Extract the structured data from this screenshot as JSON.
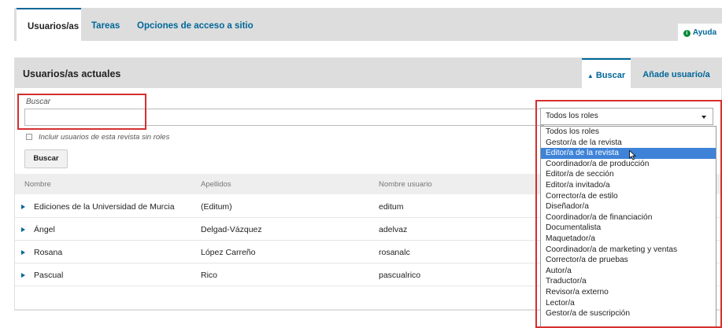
{
  "tabs": [
    {
      "label": "Usuarios/as"
    },
    {
      "label": "Tareas"
    },
    {
      "label": "Opciones de acceso a sitio"
    }
  ],
  "help_label": "Ayuda",
  "panel": {
    "title": "Usuarios/as actuales",
    "search_tab": "Buscar",
    "add_tab": "Añade usuario/a"
  },
  "search": {
    "label": "Buscar",
    "value": "",
    "checkbox_label": "Incluir usuarios de esta revista sin roles",
    "button_label": "Buscar"
  },
  "table": {
    "columns": [
      "Nombre",
      "Apellidos",
      "Nombre usuario"
    ],
    "rows": [
      [
        "Ediciones de la Universidad de Murcia",
        "(Editum)",
        "editum"
      ],
      [
        "Ángel",
        "Delgad-Vázquez",
        "adelvaz"
      ],
      [
        "Rosana",
        "López Carreño",
        "rosanalc"
      ],
      [
        "Pascual",
        "Rico",
        "pascualrico"
      ]
    ]
  },
  "roles": {
    "selected": "Todos los roles",
    "highlighted_index": 2,
    "options": [
      "Todos los roles",
      "Gestor/a de la revista",
      "Editor/a de la revista",
      "Coordinador/a de producción",
      "Editor/a de sección",
      "Editor/a invitado/a",
      "Corrector/a de estilo",
      "Diseñador/a",
      "Coordinador/a de financiación",
      "Documentalista",
      "Maquetador/a",
      "Coordinador/a de marketing y ventas",
      "Corrector/a de pruebas",
      "Autor/a",
      "Traductor/a",
      "Revisor/a externo",
      "Lector/a",
      "Gestor/a de suscripción"
    ]
  },
  "colors": {
    "accent": "#006798",
    "highlight_box": "#d62f2f",
    "selected_option": "#3f83d8"
  }
}
